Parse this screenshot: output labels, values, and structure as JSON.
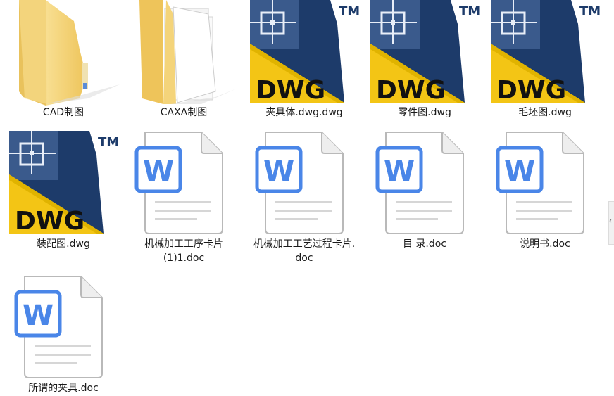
{
  "files": [
    {
      "type": "folder",
      "name": "CAD制图"
    },
    {
      "type": "folder-docs",
      "name": "CAXA制图"
    },
    {
      "type": "dwg",
      "name": "夹具体.dwg.dwg"
    },
    {
      "type": "dwg",
      "name": "零件图.dwg"
    },
    {
      "type": "dwg",
      "name": "毛坯图.dwg"
    },
    {
      "type": "dwg",
      "name": "装配图.dwg"
    },
    {
      "type": "doc",
      "name_lines": [
        "机械加工工序卡片",
        "(1)1.doc"
      ]
    },
    {
      "type": "doc",
      "name_lines": [
        "机械加工工艺过程卡片.",
        "doc"
      ]
    },
    {
      "type": "doc",
      "name": "目 录.doc"
    },
    {
      "type": "doc",
      "name": "说明书.doc"
    },
    {
      "type": "doc",
      "name": "所谓的夹具.doc"
    }
  ],
  "dwg_badge": {
    "format_text": "DWG",
    "tm_text": "TM"
  },
  "word_badge": {
    "letter": "W"
  },
  "scroll": {
    "arrow": "‹"
  },
  "colors": {
    "folder_yellow": "#f5d77e",
    "dwg_blue": "#1d3b6a",
    "dwg_yellow": "#f3c515",
    "word_blue": "#4a86e8"
  }
}
